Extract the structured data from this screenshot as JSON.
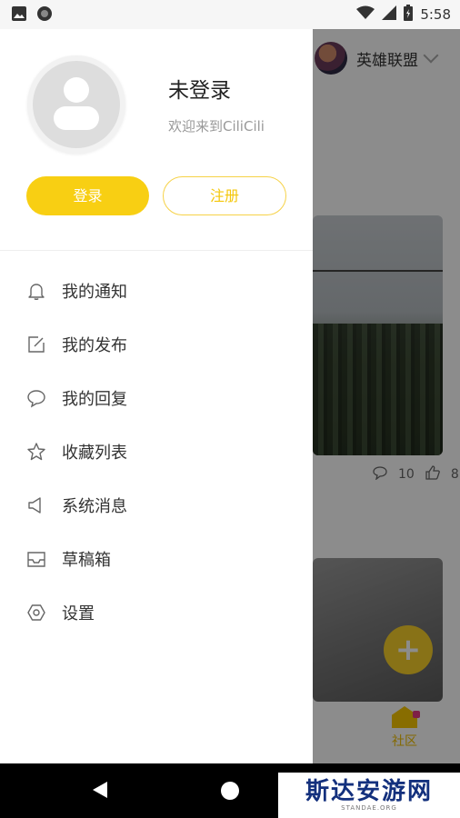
{
  "status_bar": {
    "time": "5:58",
    "left_icons": [
      "image-icon",
      "circle-status-icon"
    ],
    "right_icons": [
      "wifi-icon",
      "signal-icon",
      "battery-icon"
    ]
  },
  "background": {
    "header_title": "英雄联盟",
    "comments": "10",
    "likes": "8",
    "tab_label": "社区"
  },
  "drawer": {
    "login_title": "未登录",
    "welcome": "欢迎来到CiliCili",
    "login_button": "登录",
    "register_button": "注册",
    "menu": [
      {
        "label": "我的通知",
        "icon": "bell-icon"
      },
      {
        "label": "我的发布",
        "icon": "edit-icon"
      },
      {
        "label": "我的回复",
        "icon": "chat-bubble-icon"
      },
      {
        "label": "收藏列表",
        "icon": "star-icon"
      },
      {
        "label": "系统消息",
        "icon": "megaphone-icon"
      },
      {
        "label": "草稿箱",
        "icon": "inbox-icon"
      },
      {
        "label": "设置",
        "icon": "hexagon-settings-icon"
      }
    ]
  },
  "watermark": {
    "main": "斯达安游网",
    "sub": "STANDAE.ORG"
  },
  "colors": {
    "accent": "#f8cf13",
    "text_primary": "#333333",
    "text_secondary": "#999999"
  }
}
